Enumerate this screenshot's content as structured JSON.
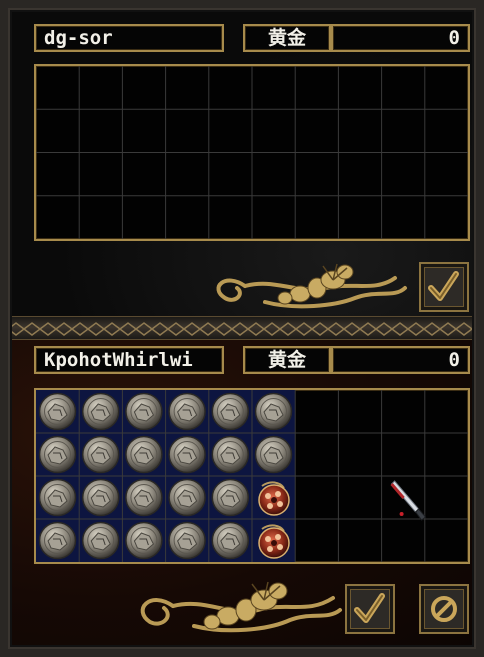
{
  "window": {
    "name": "trade-window"
  },
  "partner": {
    "name": "dg-sor",
    "gold_label": "黄金",
    "gold_value": "0",
    "grid": {
      "cols": 10,
      "rows": 4
    },
    "accept_icon": "checkmark-icon"
  },
  "player": {
    "name": "KpohotWhirlwi",
    "gold_label": "黄金",
    "gold_value": "0",
    "grid": {
      "cols": 10,
      "rows": 4
    },
    "items": [
      {
        "name": "stone",
        "count": 22,
        "icon": "stone-icon"
      },
      {
        "name": "red-charm",
        "count": 2,
        "icon": "red-charm-icon"
      },
      {
        "name": "throwing-knife",
        "count": 1,
        "icon": "throwing-knife-icon"
      }
    ],
    "accept_icon": "checkmark-icon",
    "cancel_icon": "cancel-icon"
  },
  "colors": {
    "gold_border": "#a78b4c",
    "item_slot_bg": "#0d1540",
    "text": "#f2f0e8"
  }
}
